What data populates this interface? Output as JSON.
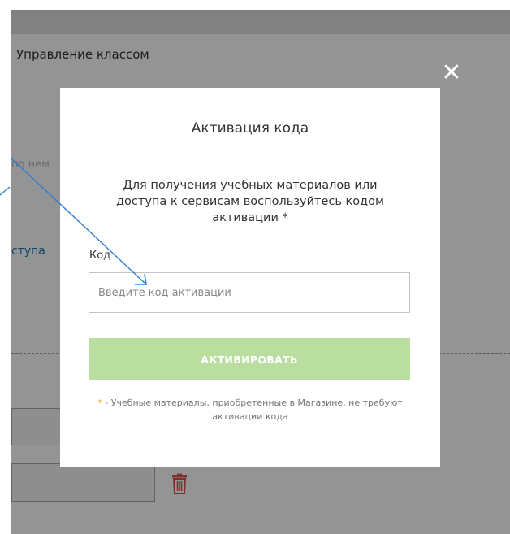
{
  "background": {
    "section_title": "Управление классом",
    "faint_text": "по нем",
    "access_link": "ступа"
  },
  "modal": {
    "title": "Активация кода",
    "description": "Для получения учебных материалов или доступа к сервисам воспользуйтесь кодом активации *",
    "code_label": "Код",
    "code_placeholder": "Введите код активации",
    "code_value": "",
    "activate_label": "АКТИВИРОВАТЬ",
    "note_star": "*",
    "note_text": " - Учебные материалы, приобретенные в Магазине, не требуют активации кода",
    "close_glyph": "✕"
  },
  "colors": {
    "accent_button": "#b9dea0",
    "link": "#1f78b4",
    "trash": "#d9534f",
    "arrow": "#2e7dd1",
    "note_star": "#f5a623"
  },
  "icons": {
    "close": "close-icon",
    "trash": "trash-icon",
    "annotation": "arrow-annotation"
  }
}
